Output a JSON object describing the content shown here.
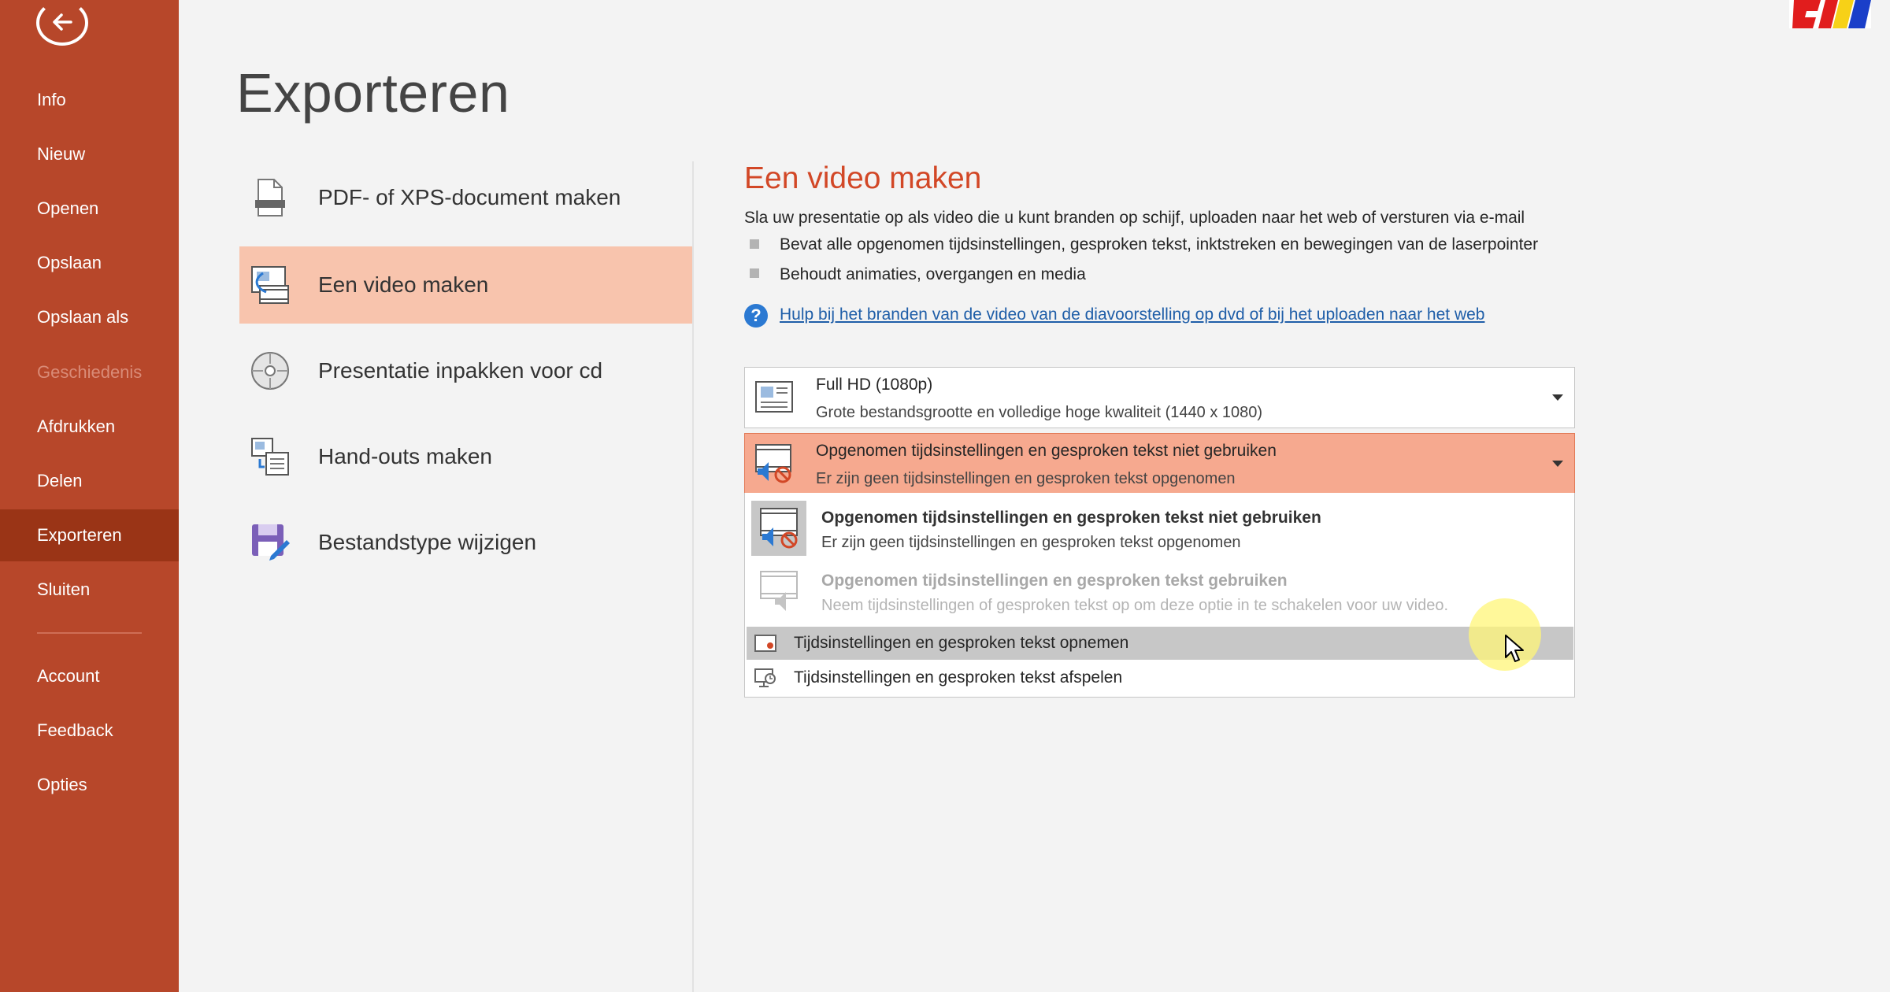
{
  "sidebar": {
    "items": [
      {
        "label": "Info",
        "state": "normal"
      },
      {
        "label": "Nieuw",
        "state": "normal"
      },
      {
        "label": "Openen",
        "state": "normal"
      },
      {
        "label": "Opslaan",
        "state": "normal"
      },
      {
        "label": "Opslaan als",
        "state": "normal"
      },
      {
        "label": "Geschiedenis",
        "state": "disabled"
      },
      {
        "label": "Afdrukken",
        "state": "normal"
      },
      {
        "label": "Delen",
        "state": "normal"
      },
      {
        "label": "Exporteren",
        "state": "active"
      },
      {
        "label": "Sluiten",
        "state": "normal"
      }
    ],
    "footer_items": [
      {
        "label": "Account"
      },
      {
        "label": "Feedback"
      },
      {
        "label": "Opties"
      }
    ]
  },
  "main": {
    "title": "Exporteren",
    "options": [
      {
        "label": "PDF- of XPS-document maken",
        "icon": "pdf-document-icon"
      },
      {
        "label": "Een video maken",
        "icon": "video-icon",
        "selected": true
      },
      {
        "label": "Presentatie inpakken voor cd",
        "icon": "cd-icon"
      },
      {
        "label": "Hand-outs maken",
        "icon": "handouts-icon"
      },
      {
        "label": "Bestandstype wijzigen",
        "icon": "change-filetype-icon"
      }
    ]
  },
  "detail": {
    "title": "Een video maken",
    "description": "Sla uw presentatie op als video die u kunt branden op schijf, uploaden naar het web of versturen via e-mail",
    "bullets": [
      "Bevat alle opgenomen tijdsinstellingen, gesproken tekst, inktstreken en bewegingen van de laserpointer",
      "Behoudt animaties, overgangen en media"
    ],
    "help_link": "Hulp bij het branden van de video van de diavoorstelling op dvd of bij het uploaden naar het web",
    "quality_dropdown": {
      "title": "Full HD (1080p)",
      "subtitle": "Grote bestandsgrootte en volledige hoge kwaliteit (1440 x 1080)"
    },
    "timing_dropdown": {
      "title": "Opgenomen tijdsinstellingen en gesproken tekst niet gebruiken",
      "subtitle": "Er zijn geen tijdsinstellingen en gesproken tekst opgenomen"
    },
    "menu": {
      "options": [
        {
          "title": "Opgenomen tijdsinstellingen en gesproken tekst niet gebruiken",
          "subtitle": "Er zijn geen tijdsinstellingen en gesproken tekst opgenomen",
          "state": "selected"
        },
        {
          "title": "Opgenomen tijdsinstellingen en gesproken tekst gebruiken",
          "subtitle": "Neem tijdsinstellingen of gesproken tekst op om deze optie in te schakelen voor uw video.",
          "state": "disabled"
        }
      ],
      "actions": [
        {
          "label": "Tijdsinstellingen en gesproken tekst opnemen",
          "state": "hover"
        },
        {
          "label": "Tijdsinstellingen en gesproken tekst afspelen",
          "state": "normal"
        }
      ]
    }
  },
  "colors": {
    "sidebar": "#b7472a",
    "sidebar_active": "#9a3416",
    "accent_text": "#d24726",
    "selected_option": "#f8c4ad",
    "open_dropdown": "#f6a98f",
    "link": "#1f5ea8"
  }
}
